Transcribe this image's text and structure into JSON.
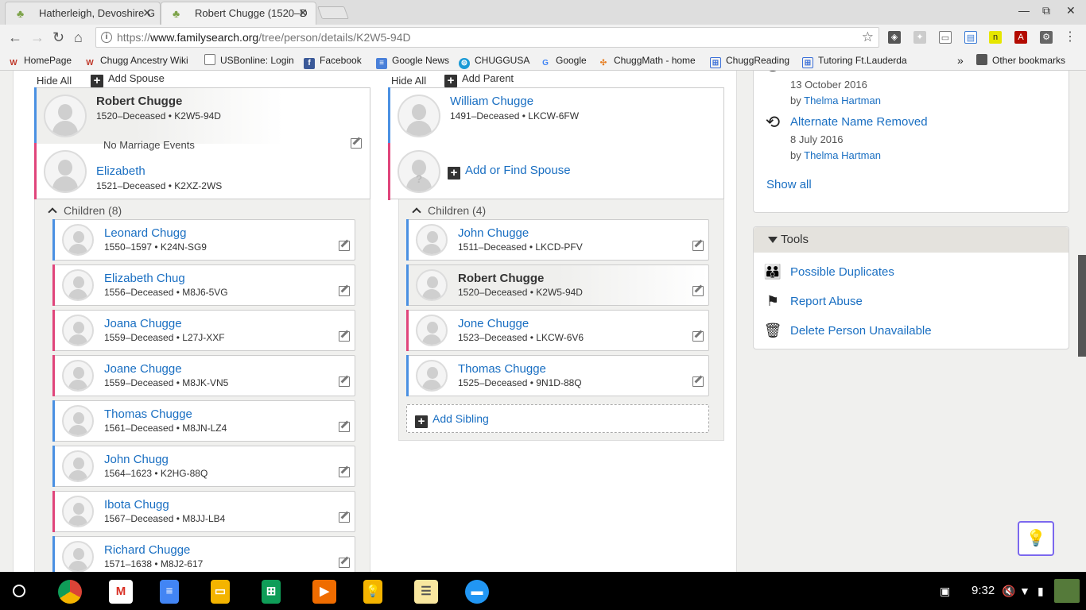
{
  "browser": {
    "tabs": [
      {
        "title": "Hatherleigh, Devoshire G",
        "active": false
      },
      {
        "title": "Robert Chugge (1520–D",
        "active": true
      }
    ],
    "url_prefix": "https://",
    "url_domain": "www.familysearch.org",
    "url_path": "/tree/person/details/K2W5-94D",
    "bookmarks": [
      {
        "label": "HomePage",
        "icon": "w-icon"
      },
      {
        "label": "Chugg Ancestry Wiki",
        "icon": "w-icon"
      },
      {
        "label": "USBonline: Login",
        "icon": "page-icon"
      },
      {
        "label": "Facebook",
        "icon": "facebook-icon"
      },
      {
        "label": "Google News",
        "icon": "news-icon"
      },
      {
        "label": "CHUGGUSA",
        "icon": "att-icon"
      },
      {
        "label": "Google",
        "icon": "google-icon"
      },
      {
        "label": "ChuggMath - home",
        "icon": "pinwheel-icon"
      },
      {
        "label": "ChuggReading",
        "icon": "grid-icon"
      },
      {
        "label": "Tutoring Ft.Lauderda",
        "icon": "grid-icon"
      }
    ],
    "overflow_label": "»",
    "other_bookmarks": "Other bookmarks"
  },
  "family": {
    "hide_all": "Hide All",
    "add_spouse": "Add Spouse",
    "add_parent": "Add Parent",
    "spouses": {
      "husband": {
        "name": "Robert Chugge",
        "meta": "1520–Deceased • K2W5-94D"
      },
      "marriage": "No Marriage Events",
      "wife": {
        "name": "Elizabeth",
        "meta": "1521–Deceased • K2XZ-2WS"
      }
    },
    "children_label": "Children (8)",
    "children": [
      {
        "name": "Leonard Chugg",
        "meta": "1550–1597 • K24N-SG9",
        "sex": "m"
      },
      {
        "name": "Elizabeth Chug",
        "meta": "1556–Deceased • M8J6-5VG",
        "sex": "f"
      },
      {
        "name": "Joana Chugge",
        "meta": "1559–Deceased • L27J-XXF",
        "sex": "f"
      },
      {
        "name": "Joane Chugge",
        "meta": "1559–Deceased • M8JK-VN5",
        "sex": "f"
      },
      {
        "name": "Thomas Chugge",
        "meta": "1561–Deceased • M8JN-LZ4",
        "sex": "m"
      },
      {
        "name": "John Chugg",
        "meta": "1564–1623 • K2HG-88Q",
        "sex": "m"
      },
      {
        "name": "Ibota Chugg",
        "meta": "1567–Deceased • M8JJ-LB4",
        "sex": "f"
      },
      {
        "name": "Richard Chugge",
        "meta": "1571–1638 • M8J2-617",
        "sex": "m"
      }
    ],
    "parents": {
      "father": {
        "name": "William Chugge",
        "meta": "1491–Deceased • LKCW-6FW"
      },
      "add_find_spouse": "Add or Find Spouse"
    },
    "siblings_label": "Children (4)",
    "siblings": [
      {
        "name": "John Chugge",
        "meta": "1511–Deceased • LKCD-PFV",
        "sex": "m",
        "current": false
      },
      {
        "name": "Robert Chugge",
        "meta": "1520–Deceased • K2W5-94D",
        "sex": "m",
        "current": true
      },
      {
        "name": "Jone Chugge",
        "meta": "1523–Deceased • LKCW-6V6",
        "sex": "f",
        "current": false
      },
      {
        "name": "Thomas Chugge",
        "meta": "1525–Deceased • 9N1D-88Q",
        "sex": "m",
        "current": false
      }
    ],
    "add_sibling": "Add Sibling"
  },
  "changes": [
    {
      "date": "13 October 2016",
      "by_prefix": "by",
      "by": "Thelma Hartman"
    },
    {
      "title": "Alternate Name Removed",
      "date": "8 July 2016",
      "by_prefix": "by",
      "by": "Thelma Hartman"
    }
  ],
  "show_all": "Show all",
  "tools": {
    "title": "Tools",
    "items": [
      {
        "label": "Possible Duplicates",
        "icon": "people-icon"
      },
      {
        "label": "Report Abuse",
        "icon": "flag-icon"
      },
      {
        "label": "Delete Person Unavailable",
        "icon": "trash-icon"
      }
    ]
  },
  "shelf": {
    "time": "9:32",
    "apps": [
      "chrome",
      "gmail",
      "docs",
      "slides",
      "sheets",
      "play-music",
      "keep",
      "notes",
      "files"
    ]
  },
  "colors": {
    "link": "#1a6fc2",
    "male": "#4a90e2",
    "female": "#e0457b",
    "panel_bg": "#f0f0ee"
  }
}
